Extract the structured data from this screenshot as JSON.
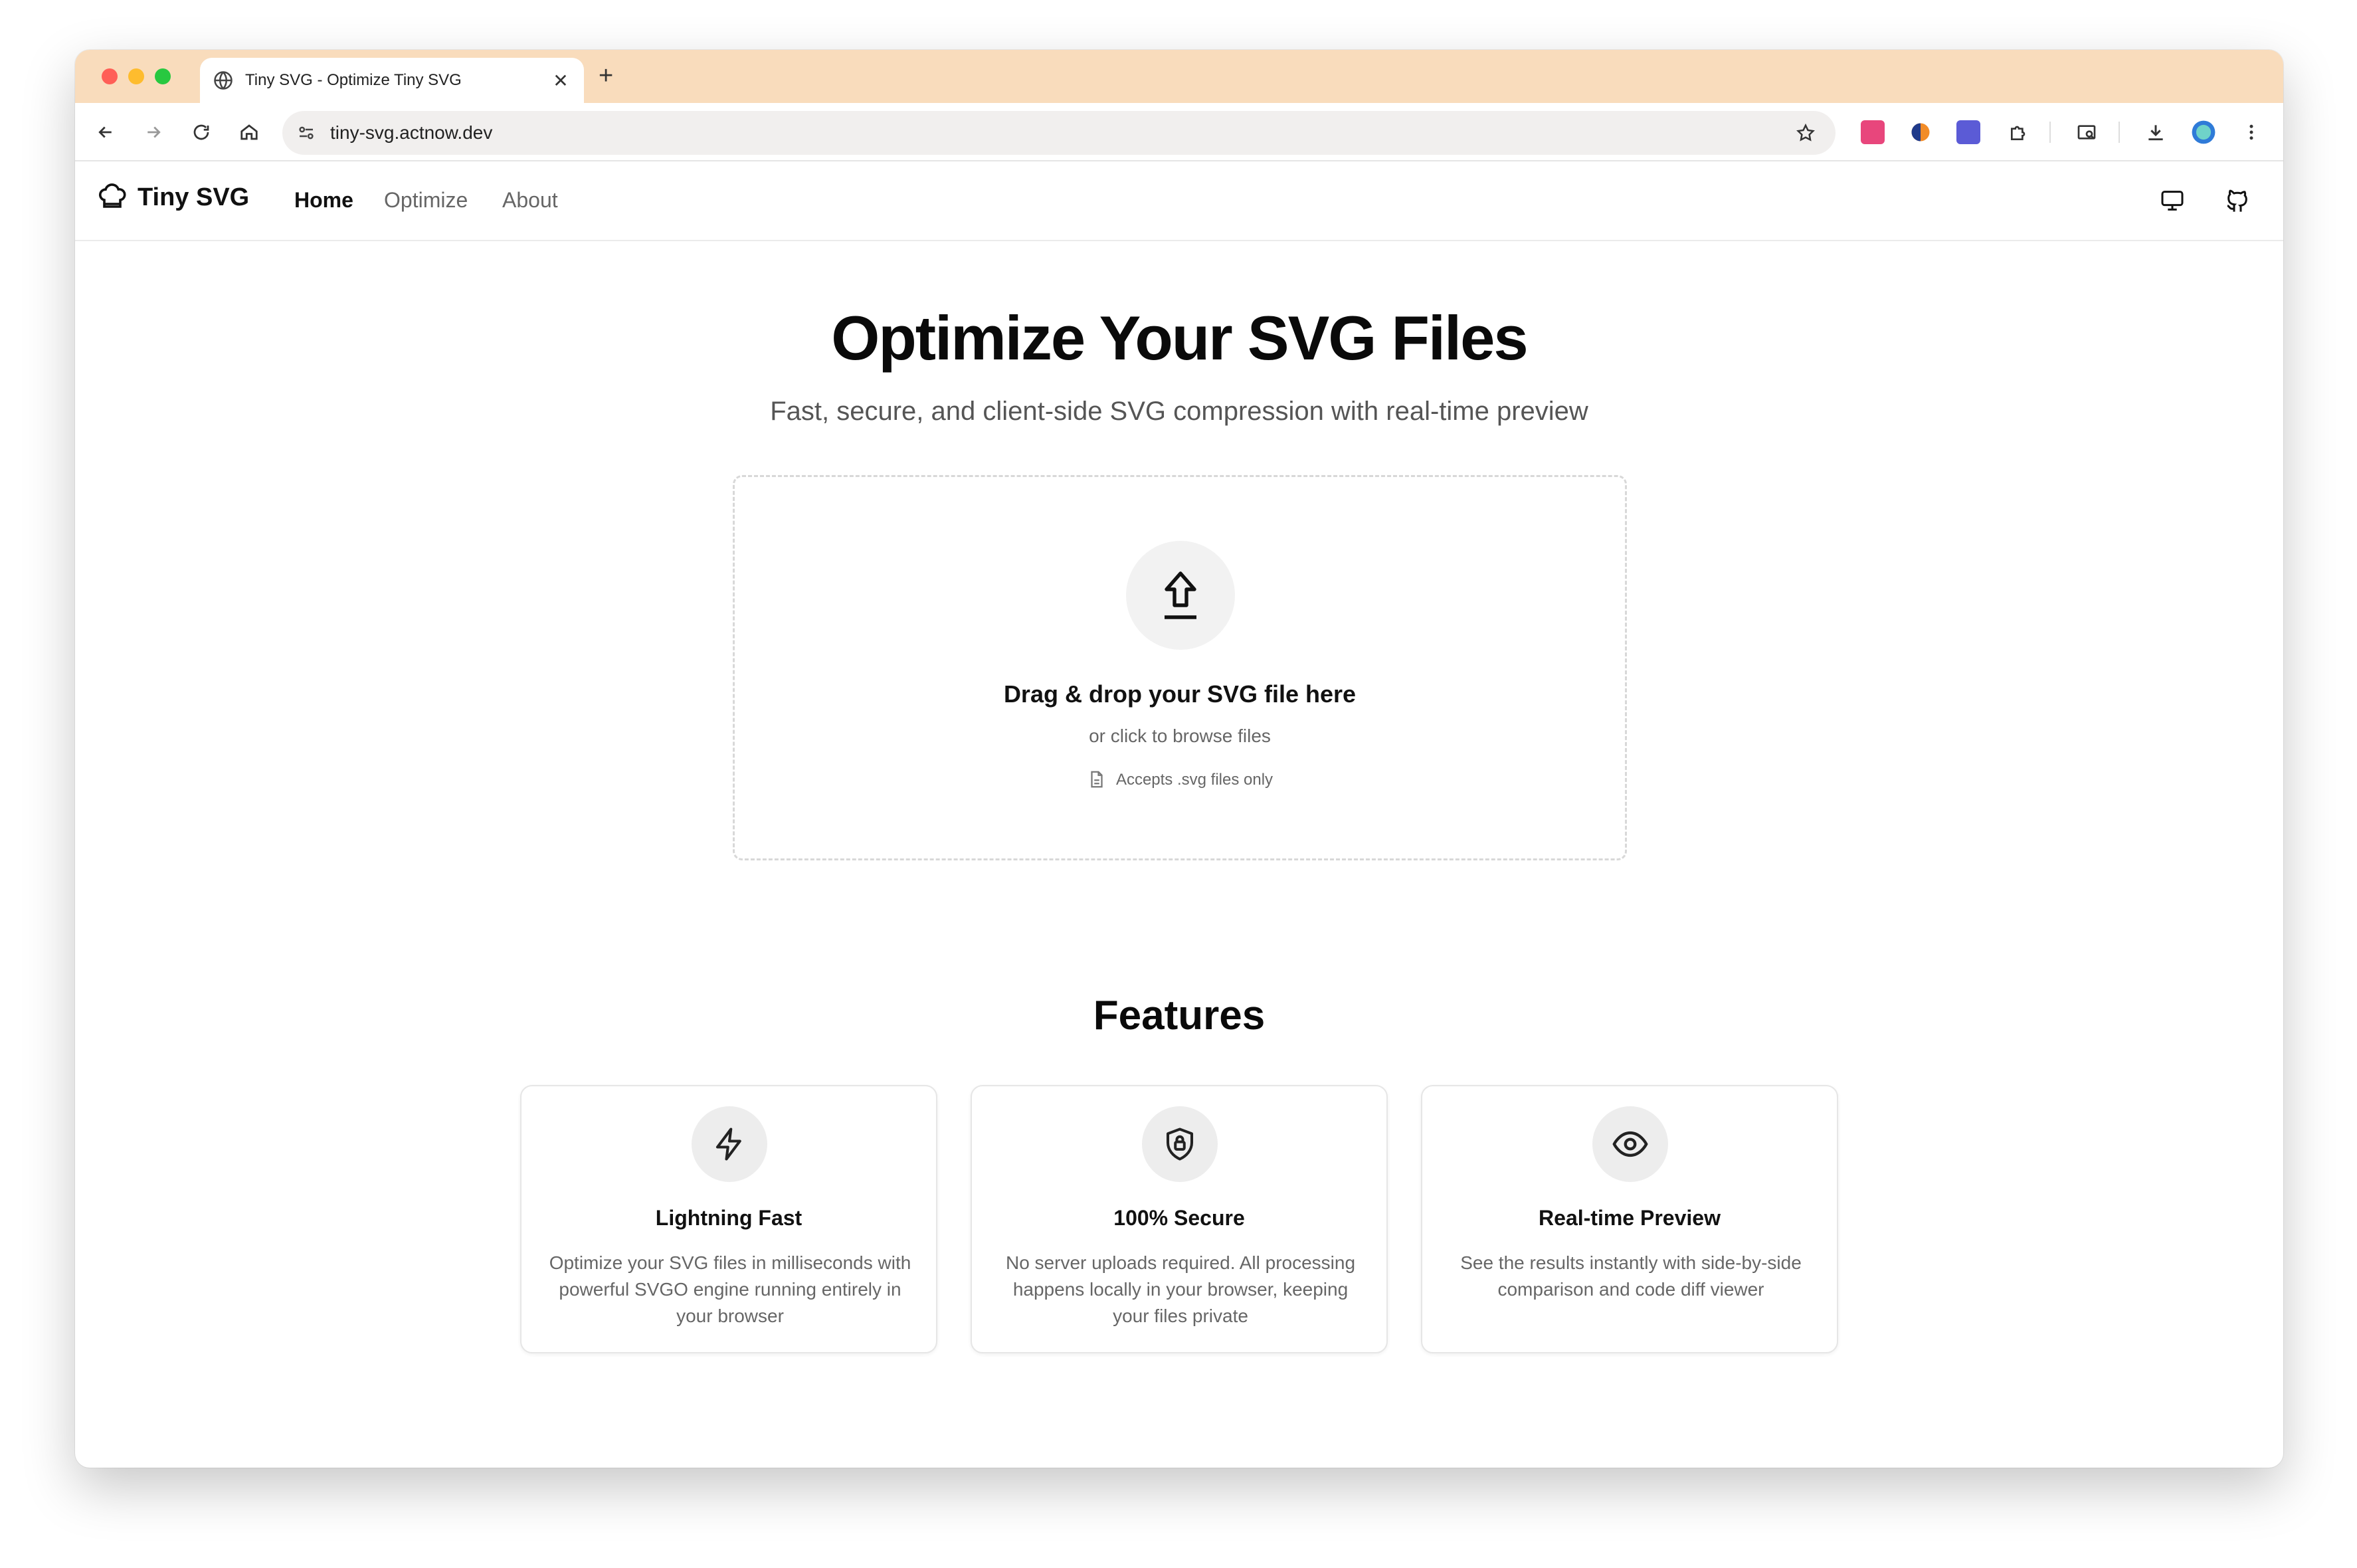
{
  "browser": {
    "tab_title": "Tiny SVG - Optimize Tiny SVG",
    "tab_close": "✕",
    "new_tab": "+",
    "url": "tiny-svg.actnow.dev",
    "extension_colors": [
      "#e8467c",
      "#f28c28",
      "#5b5bd6"
    ]
  },
  "nav": {
    "brand": "Tiny SVG",
    "links": [
      "Home",
      "Optimize",
      "About"
    ],
    "active": "Home",
    "right_icons": [
      "monitor-icon",
      "github-icon"
    ]
  },
  "hero": {
    "title": "Optimize Your SVG Files",
    "subtitle": "Fast, secure, and client-side SVG compression with real-time preview"
  },
  "dropzone": {
    "title": "Drag & drop your SVG file here",
    "subtitle": "or click to browse files",
    "accepts": "Accepts .svg files only"
  },
  "features": {
    "title": "Features",
    "cards": [
      {
        "icon": "lightning-icon",
        "title": "Lightning Fast",
        "description": "Optimize your SVG files in milliseconds with powerful SVGO engine running entirely in your browser"
      },
      {
        "icon": "shield-lock-icon",
        "title": "100% Secure",
        "description": "No server uploads required. All processing happens locally in your browser, keeping your files private"
      },
      {
        "icon": "eye-icon",
        "title": "Real-time Preview",
        "description": "See the results instantly with side-by-side comparison and code diff viewer"
      }
    ]
  }
}
